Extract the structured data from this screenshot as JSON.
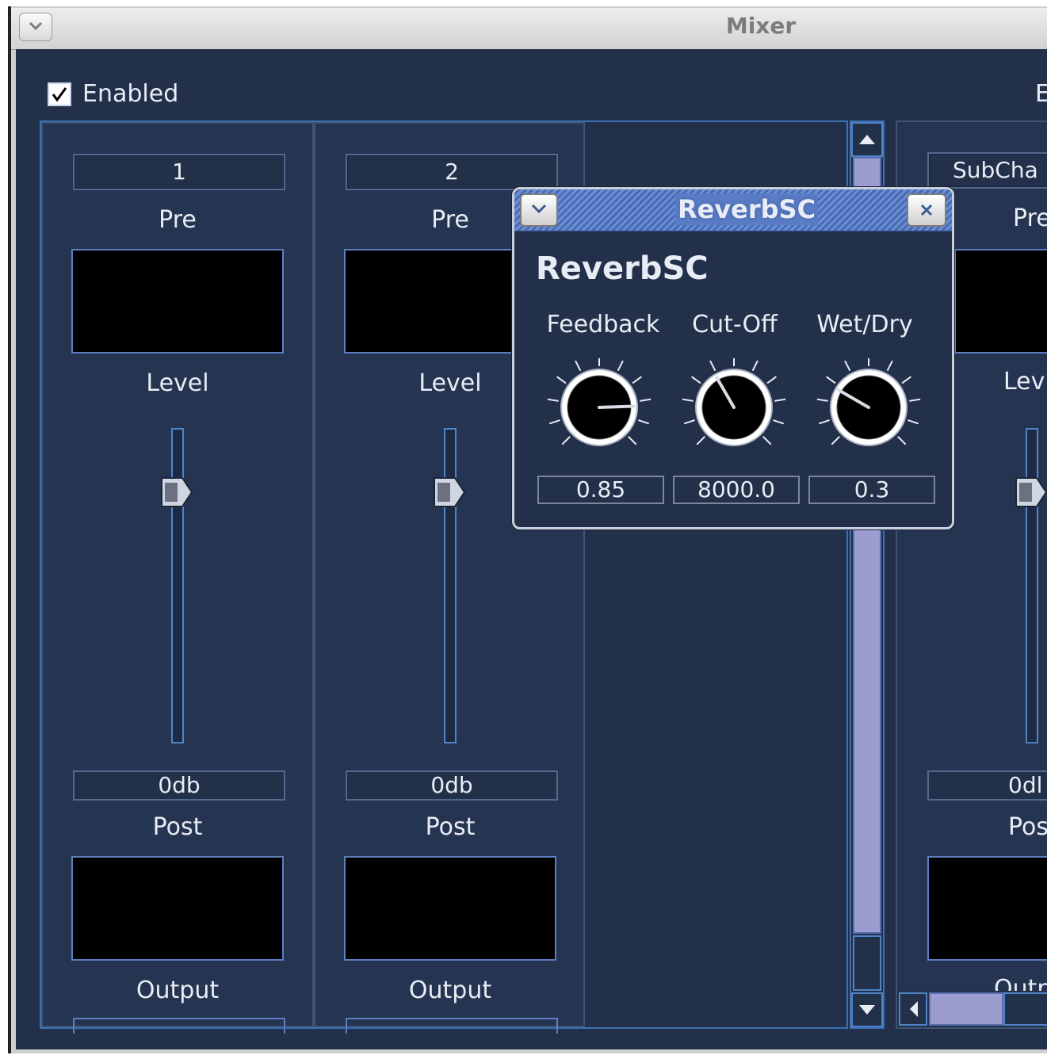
{
  "window": {
    "title": "Mixer"
  },
  "enabled": {
    "label": "Enabled",
    "checked": true
  },
  "right_cut_label": "E",
  "strips": [
    {
      "name": "1",
      "pre_label": "Pre",
      "level_label": "Level",
      "db": "0db",
      "post_label": "Post",
      "output_label": "Output"
    },
    {
      "name": "2",
      "pre_label": "Pre",
      "level_label": "Level",
      "db": "0db",
      "post_label": "Post",
      "output_label": "Output"
    }
  ],
  "subchannel_strip": {
    "name": "SubCha",
    "pre_label": "Pre",
    "level_label": "Lev",
    "db": "0dl",
    "post_label": "Pos",
    "output_label": "Outp"
  },
  "popup": {
    "title": "ReverbSC",
    "heading": "ReverbSC",
    "knobs": [
      {
        "label": "Feedback",
        "value": "0.85"
      },
      {
        "label": "Cut-Off",
        "value": "8000.0"
      },
      {
        "label": "Wet/Dry",
        "value": "0.3"
      }
    ]
  },
  "colors": {
    "background": "#223049",
    "accent": "#4f84c9",
    "scroll_thumb": "#9d9cd1"
  },
  "icons": {
    "window_menu": "chevron-down-icon",
    "popup_close": "close-icon"
  }
}
